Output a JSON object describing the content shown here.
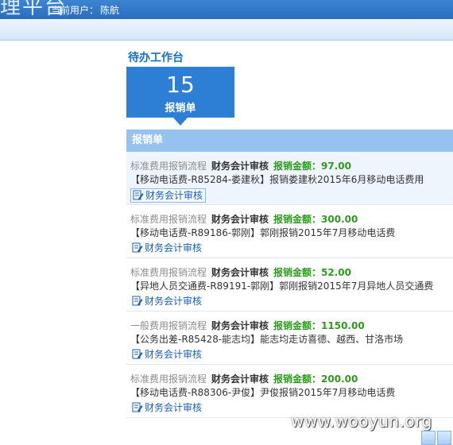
{
  "header": {
    "brand": "理平台",
    "user_label": "当前用户：",
    "user_name": "陈航"
  },
  "section": {
    "title": "待办工作台",
    "count": "15",
    "count_label": "报销单"
  },
  "list": {
    "header": "报销单",
    "items": [
      {
        "flow": "标准费用报销流程",
        "stage": "财务会计审核",
        "amount": "报销金额：97.00",
        "detail": "【移动电话费-R85284-娄建秋】报销娄建秋2015年6月移动电话费用",
        "action": "财务会计审核"
      },
      {
        "flow": "标准费用报销流程",
        "stage": "财务会计审核",
        "amount": "报销金额：300.00",
        "detail": "【移动电话费-R89186-郭刚】郭刚报销2015年7月移动电话费",
        "action": "财务会计审核"
      },
      {
        "flow": "标准费用报销流程",
        "stage": "财务会计审核",
        "amount": "报销金额：52.00",
        "detail": "【异地人员交通费-R89191-郭刚】郭刚报销2015年7月异地人员交通费",
        "action": "财务会计审核"
      },
      {
        "flow": "一般费用报销流程",
        "stage": "财务会计审核",
        "amount": "报销金额：1150.00",
        "detail": "【公务出差-R85428-能志均】能志均走访喜德、越西、甘洛市场",
        "action": "财务会计审核"
      },
      {
        "flow": "标准费用报销流程",
        "stage": "财务会计审核",
        "amount": "报销金额：200.00",
        "detail": "【移动电话费-R88306-尹俊】尹俊报销2015年7月移动电话费",
        "action": "财务会计审核"
      }
    ]
  },
  "watermark": "www.wooyun.org",
  "colors": {
    "accent": "#2c7fd4",
    "list_header": "#96c2ef",
    "amount": "#2e9a1e"
  }
}
